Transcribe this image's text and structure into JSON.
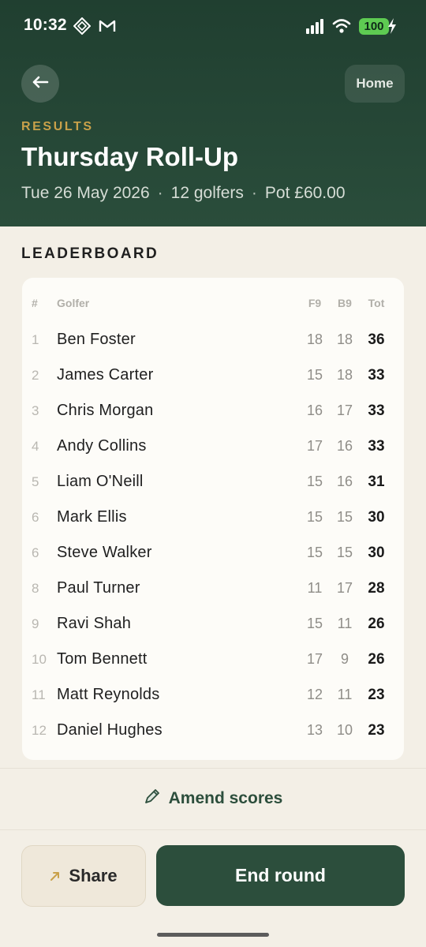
{
  "status_bar": {
    "time": "10:32",
    "battery": "100",
    "icons": [
      "app-diamond-icon",
      "gmail-icon",
      "signal-icon",
      "wifi-icon",
      "battery-icon",
      "charging-bolt-icon"
    ]
  },
  "header": {
    "back_icon": "back-arrow-icon",
    "home_label": "Home",
    "eyebrow": "RESULTS",
    "title": "Thursday Roll-Up",
    "date": "Tue 26 May 2026",
    "golfers": "12 golfers",
    "pot": "Pot £60.00",
    "separator": "·"
  },
  "leaderboard": {
    "heading": "LEADERBOARD",
    "columns": {
      "rank": "#",
      "golfer": "Golfer",
      "f9": "F9",
      "b9": "B9",
      "tot": "Tot"
    },
    "rows": [
      {
        "rank": "1",
        "name": "Ben Foster",
        "f9": "18",
        "b9": "18",
        "tot": "36"
      },
      {
        "rank": "2",
        "name": "James Carter",
        "f9": "15",
        "b9": "18",
        "tot": "33"
      },
      {
        "rank": "3",
        "name": "Chris Morgan",
        "f9": "16",
        "b9": "17",
        "tot": "33"
      },
      {
        "rank": "4",
        "name": "Andy Collins",
        "f9": "17",
        "b9": "16",
        "tot": "33"
      },
      {
        "rank": "5",
        "name": "Liam O'Neill",
        "f9": "15",
        "b9": "16",
        "tot": "31"
      },
      {
        "rank": "6",
        "name": "Mark Ellis",
        "f9": "15",
        "b9": "15",
        "tot": "30"
      },
      {
        "rank": "6",
        "name": "Steve Walker",
        "f9": "15",
        "b9": "15",
        "tot": "30"
      },
      {
        "rank": "8",
        "name": "Paul Turner",
        "f9": "11",
        "b9": "17",
        "tot": "28"
      },
      {
        "rank": "9",
        "name": "Ravi Shah",
        "f9": "15",
        "b9": "11",
        "tot": "26"
      },
      {
        "rank": "10",
        "name": "Tom Bennett",
        "f9": "17",
        "b9": "9",
        "tot": "26"
      },
      {
        "rank": "11",
        "name": "Matt Reynolds",
        "f9": "12",
        "b9": "11",
        "tot": "23"
      },
      {
        "rank": "12",
        "name": "Daniel Hughes",
        "f9": "13",
        "b9": "10",
        "tot": "23"
      }
    ]
  },
  "actions": {
    "amend_label": "Amend scores",
    "amend_icon": "pencil-icon",
    "share_label": "Share",
    "share_icon": "share-arrow-icon",
    "end_label": "End round"
  },
  "colors": {
    "header_green": "#203f30",
    "accent_gold": "#c9a14a",
    "primary_green": "#2c4e3c",
    "background": "#f3efe6",
    "battery_green": "#5ecb52"
  }
}
